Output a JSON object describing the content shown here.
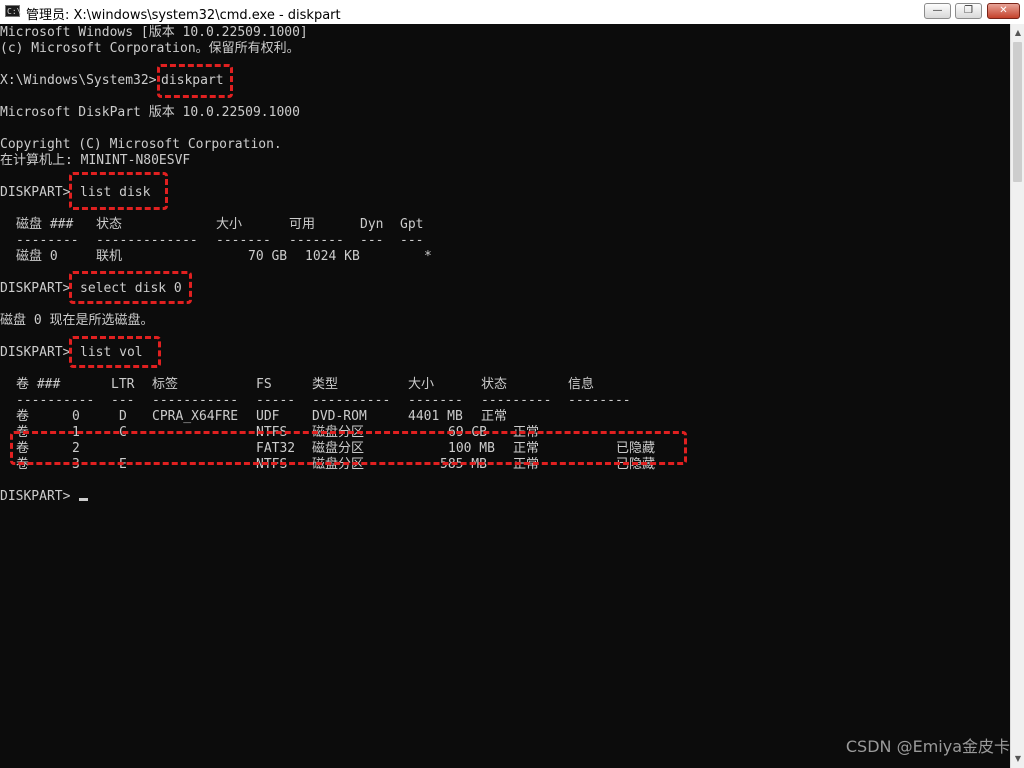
{
  "window": {
    "title": "管理员: X:\\windows\\system32\\cmd.exe - diskpart",
    "icon_label": "C:\\",
    "buttons": {
      "minimize": "—",
      "maximize": "❐",
      "close": "✕"
    }
  },
  "console": {
    "banner1": "Microsoft Windows [版本 10.0.22509.1000]",
    "banner2": "(c) Microsoft Corporation。保留所有权利。",
    "prompt_sys": "X:\\Windows\\System32>",
    "cmd_diskpart": "diskpart",
    "dp_version": "Microsoft DiskPart 版本 10.0.22509.1000",
    "copyright": "Copyright (C) Microsoft Corporation.",
    "computer": "在计算机上: MININT-N80ESVF",
    "prompt": "DISKPART>",
    "cmd_list_disk": "list disk",
    "cmd_select_disk": "select disk 0",
    "select_result": "磁盘 0 现在是所选磁盘。",
    "cmd_list_vol": "list vol"
  },
  "disk_table": {
    "headers": [
      "磁盘 ###",
      "状态",
      "大小",
      "可用",
      "Dyn",
      "Gpt"
    ],
    "separators": [
      "--------",
      "-------------",
      "-------",
      "-------",
      "---",
      "---"
    ],
    "rows": [
      {
        "disk": "磁盘 0",
        "status": "联机",
        "size": "70 GB",
        "free": "1024 KB",
        "dyn": "",
        "gpt": "*"
      }
    ]
  },
  "vol_table": {
    "headers": [
      "卷 ###",
      "LTR",
      "标签",
      "FS",
      "类型",
      "大小",
      "状态",
      "信息"
    ],
    "separators": [
      "----------",
      "---",
      "-----------",
      "-----",
      "----------",
      "-------",
      "---------",
      "--------"
    ],
    "rows": [
      {
        "vol": "卷",
        "num": "0",
        "ltr": "D",
        "label": "CPRA_X64FRE",
        "fs": "UDF",
        "type": "DVD-ROM",
        "size": "4401 MB",
        "status": "正常",
        "info": ""
      },
      {
        "vol": "卷",
        "num": "1",
        "ltr": "C",
        "label": "",
        "fs": "NTFS",
        "type": "磁盘分区",
        "size": "69 GB",
        "status": "正常",
        "info": ""
      },
      {
        "vol": "卷",
        "num": "2",
        "ltr": "",
        "label": "",
        "fs": "FAT32",
        "type": "磁盘分区",
        "size": "100 MB",
        "status": "正常",
        "info": "已隐藏"
      },
      {
        "vol": "卷",
        "num": "3",
        "ltr": "E",
        "label": "",
        "fs": "NTFS",
        "type": "磁盘分区",
        "size": "585 MB",
        "status": "正常",
        "info": "已隐藏"
      }
    ]
  },
  "watermark": "CSDN @Emiya金皮卡",
  "colors": {
    "console_bg": "#0c0c0c",
    "console_fg": "#cccccc",
    "highlight": "#e02020"
  }
}
